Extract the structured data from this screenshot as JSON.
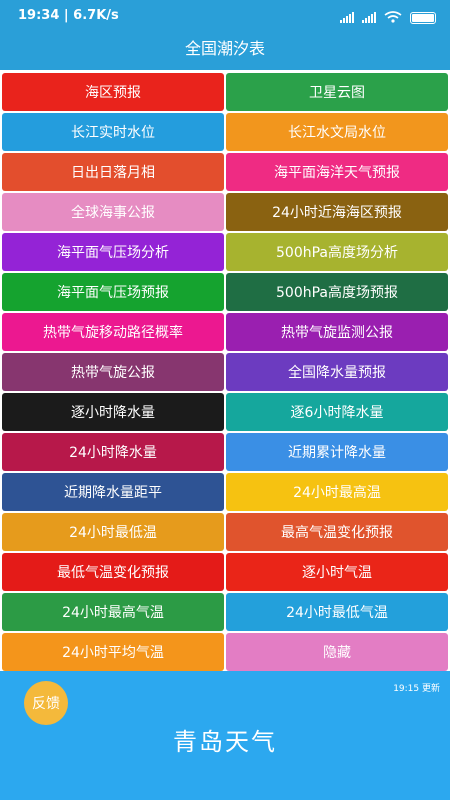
{
  "status": {
    "time": "19:34 | 6.7K/s"
  },
  "header": {
    "title": "全国潮汐表"
  },
  "menu": [
    {
      "label": "海区预报",
      "color": "#e9231c"
    },
    {
      "label": "卫星云图",
      "color": "#2ba14a"
    },
    {
      "label": "长江实时水位",
      "color": "#249ddd"
    },
    {
      "label": "长江水文局水位",
      "color": "#f2961d"
    },
    {
      "label": "日出日落月相",
      "color": "#e34e2d"
    },
    {
      "label": "海平面海洋天气预报",
      "color": "#ef2b83"
    },
    {
      "label": "全球海事公报",
      "color": "#e68cc2"
    },
    {
      "label": "24小时近海海区预报",
      "color": "#8a6211"
    },
    {
      "label": "海平面气压场分析",
      "color": "#9423d6"
    },
    {
      "label": "500hPa高度场分析",
      "color": "#a7b32f"
    },
    {
      "label": "海平面气压场预报",
      "color": "#15a32f"
    },
    {
      "label": "500hPa高度场预报",
      "color": "#1f6e44"
    },
    {
      "label": "热带气旋移动路径概率",
      "color": "#ec1890"
    },
    {
      "label": "热带气旋监测公报",
      "color": "#9a1fb0"
    },
    {
      "label": "热带气旋公报",
      "color": "#87366f"
    },
    {
      "label": "全国降水量预报",
      "color": "#6c3bc0"
    },
    {
      "label": "逐小时降水量",
      "color": "#1b1b1b"
    },
    {
      "label": "逐6小时降水量",
      "color": "#15a79d"
    },
    {
      "label": "24小时降水量",
      "color": "#b7184a"
    },
    {
      "label": "近期累计降水量",
      "color": "#3a8fe5"
    },
    {
      "label": "近期降水量距平",
      "color": "#2e5394"
    },
    {
      "label": "24小时最高温",
      "color": "#f6c211"
    },
    {
      "label": "24小时最低温",
      "color": "#e69b1c"
    },
    {
      "label": "最高气温变化预报",
      "color": "#e0542d"
    },
    {
      "label": "最低气温变化预报",
      "color": "#e41b18"
    },
    {
      "label": "逐小时气温",
      "color": "#ea2518"
    },
    {
      "label": "24小时最高气温",
      "color": "#2c9b45"
    },
    {
      "label": "24小时最低气温",
      "color": "#23a0db"
    },
    {
      "label": "24小时平均气温",
      "color": "#f4951b"
    },
    {
      "label": "隐藏",
      "color": "#e37dc4"
    }
  ],
  "weather": {
    "feedback": "反馈",
    "update": "19:15 更新",
    "city": "青岛天气"
  }
}
